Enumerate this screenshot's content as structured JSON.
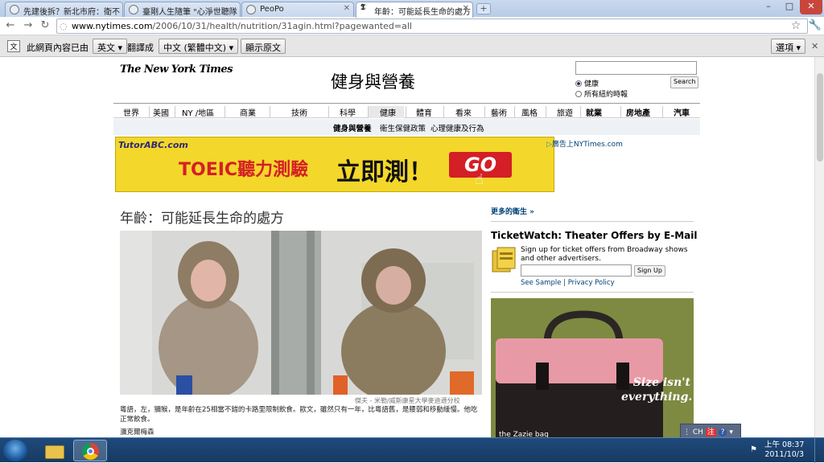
{
  "browser": {
    "tabs": [
      {
        "label": "先建後拆？新北市府：衛不"
      },
      {
        "label": "臺剛人生隨筆 \"心淨世聽隊"
      },
      {
        "label": "PeoPo"
      },
      {
        "label": "年齡：可能延長生命的處方"
      }
    ],
    "new_tab_label": "+",
    "window_controls": {
      "min": "–",
      "max": "□",
      "close": "✕"
    },
    "url_host": "www.nytimes.com",
    "url_path": "/2006/10/31/health/nutrition/31agin.html?pagewanted=all"
  },
  "translate_bar": {
    "prefix": "此網頁內容已由",
    "source_lang": "英文",
    "translated_to": "翻譯成",
    "target_lang": "中文 (繁體中文)",
    "show_original": "顯示原文",
    "options": "選項"
  },
  "page": {
    "logo_text": "The New York Times",
    "section_title": "健身與營養",
    "search": {
      "button": "Search",
      "radio_health": "健康",
      "radio_all": "所有紐約時報"
    },
    "nav_tabs": [
      "世界",
      "美國",
      "NY /地區",
      "商業",
      "技術",
      "科學",
      "健康",
      "體育",
      "看來",
      "藝術",
      "風格",
      "旅遊",
      "就業",
      "房地產",
      "汽車"
    ],
    "subnav": [
      "健身與營養",
      "衛生保健政策",
      "心理健康及行為"
    ],
    "ad": {
      "brand": "TutorABC.com",
      "toeic": "TOEIC聽力測驗",
      "cta": "立即測！",
      "go": "GO"
    },
    "ad_link": "廣告上NYTimes.com",
    "headline": "年齡：可能延長生命的處方",
    "photo_credit": "傑夫 - 米勒/威斯康星大學麥迪遜分校",
    "caption": "粵語，左，獼猴，是年齡在25相當不錯的卡路里限制飲食。歐文，雖然只有一年，比粵語舊，是腰弱和移動緩慢。他吃正常飲食。",
    "byline": "瀰克爾梅森",
    "right": {
      "more_link": "更多的衛生 »",
      "tw_title": "TicketWatch: Theater Offers by E-Mail",
      "tw_text": "Sign up for ticket offers from Broadway shows and other advertisers.",
      "tw_button": "Sign Up",
      "tw_links": "See Sample | Privacy Policy",
      "bag_copy_1": "Size isn't",
      "bag_copy_2": "everything.",
      "bag_brand": "the Zazie bag"
    }
  },
  "ime": {
    "label": "CH"
  },
  "taskbar": {
    "time": "上午 08:37",
    "date": "2011/10/3"
  }
}
